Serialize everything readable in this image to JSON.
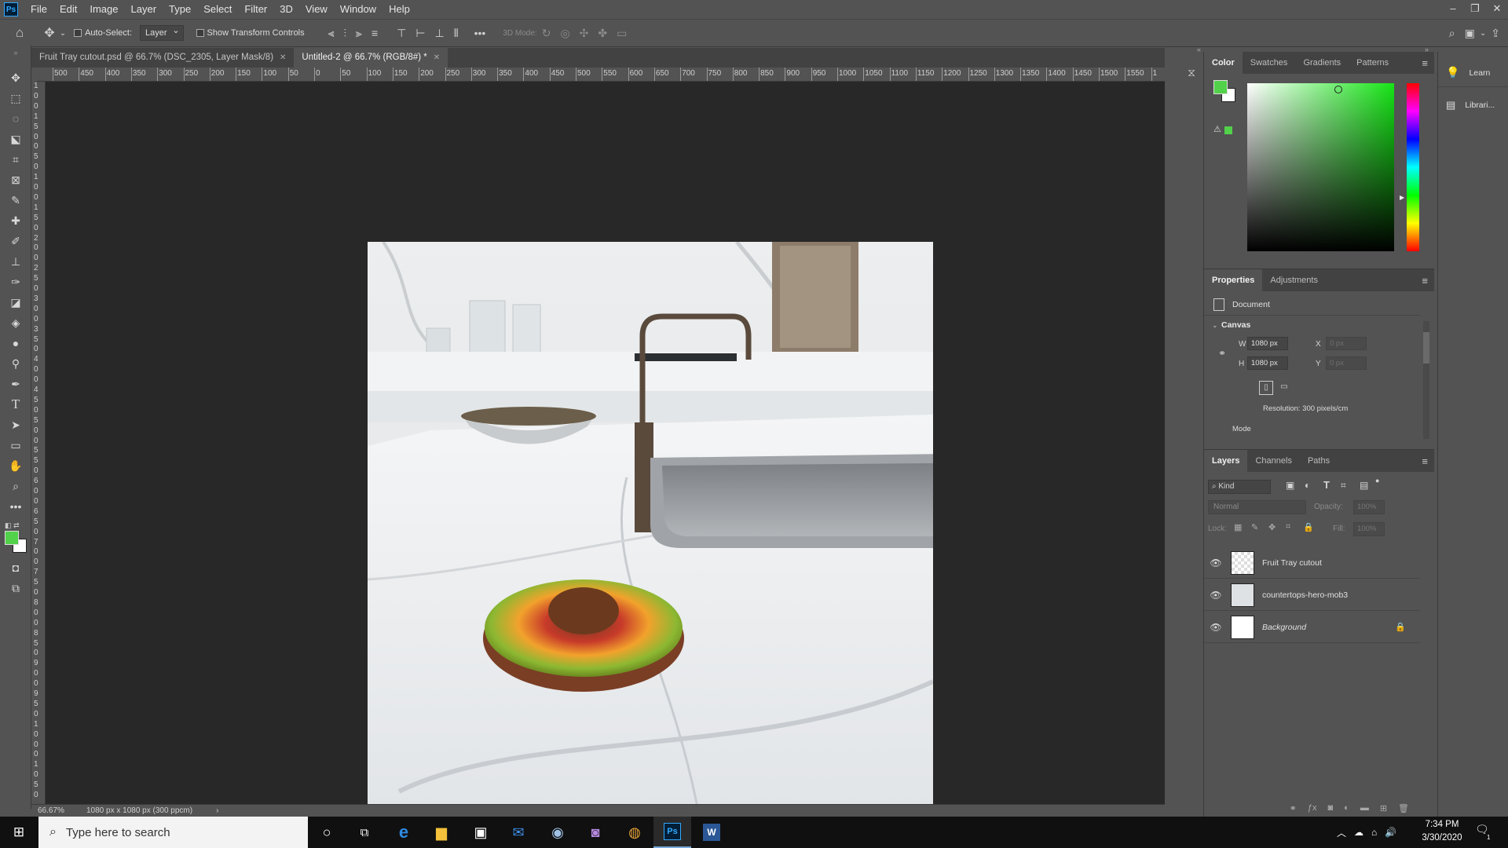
{
  "app": {
    "logo": "Ps"
  },
  "menu": [
    "File",
    "Edit",
    "Image",
    "Layer",
    "Type",
    "Select",
    "Filter",
    "3D",
    "View",
    "Window",
    "Help"
  ],
  "window_controls": {
    "minimize": "–",
    "restore": "❐",
    "close": "✕"
  },
  "options_bar": {
    "auto_select_label": "Auto-Select:",
    "auto_select_value": "Layer",
    "show_transform_label": "Show Transform Controls",
    "mode_3d_label": "3D Mode:",
    "more": "•••"
  },
  "doc_tabs": [
    {
      "label": "Fruit Tray cutout.psd @ 66.7% (DSC_2305, Layer Mask/8)",
      "active": false
    },
    {
      "label": "Untitled-2 @ 66.7% (RGB/8#) *",
      "active": true
    }
  ],
  "ruler_top": [
    "500",
    "450",
    "400",
    "350",
    "300",
    "250",
    "200",
    "150",
    "100",
    "50",
    "0",
    "50",
    "100",
    "150",
    "200",
    "250",
    "300",
    "350",
    "400",
    "450",
    "500",
    "550",
    "600",
    "650",
    "700",
    "750",
    "800",
    "850",
    "900",
    "950",
    "1000",
    "1050",
    "1100",
    "1150",
    "1200",
    "1250",
    "1300",
    "1350",
    "1400",
    "1450",
    "1500",
    "1550",
    "1"
  ],
  "ruler_left": [
    "1",
    "0",
    "0",
    "1",
    "5",
    "0",
    "0",
    "5",
    "0",
    "1",
    "0",
    "0",
    "1",
    "5",
    "0",
    "2",
    "0",
    "0",
    "2",
    "5",
    "0",
    "3",
    "0",
    "0",
    "3",
    "5",
    "0",
    "4",
    "0",
    "0",
    "4",
    "5",
    "0",
    "5",
    "0",
    "0",
    "5",
    "5",
    "0",
    "6",
    "0",
    "0",
    "6",
    "5",
    "0",
    "7",
    "0",
    "0",
    "7",
    "5",
    "0",
    "8",
    "0",
    "0",
    "8",
    "5",
    "0",
    "9",
    "0",
    "0",
    "9",
    "5",
    "0",
    "1",
    "0",
    "0",
    "0",
    "1",
    "0",
    "5",
    "0"
  ],
  "status": {
    "zoom": "66.67%",
    "doc_info": "1080 px x 1080 px (300 ppcm)",
    "arrow": "›"
  },
  "colors": {
    "foreground": "#52d14a",
    "background": "#ffffff",
    "picker_hue": "#16e416"
  },
  "color_panel": {
    "tabs": [
      "Color",
      "Swatches",
      "Gradients",
      "Patterns"
    ],
    "warn": "⚠"
  },
  "properties_panel": {
    "tabs": [
      "Properties",
      "Adjustments"
    ],
    "doc_label": "Document",
    "section": "Canvas",
    "w_label": "W",
    "w_value": "1080 px",
    "h_label": "H",
    "h_value": "1080 px",
    "x_label": "X",
    "x_placeholder": "0 px",
    "y_label": "Y",
    "y_placeholder": "0 px",
    "resolution": "Resolution: 300 pixels/cm",
    "mode_label": "Mode"
  },
  "layers_panel": {
    "tabs": [
      "Layers",
      "Channels",
      "Paths"
    ],
    "filter": "Kind",
    "blend": "Normal",
    "opacity_label": "Opacity:",
    "opacity_value": "100%",
    "lock_label": "Lock:",
    "fill_label": "Fill:",
    "fill_value": "100%",
    "layers": [
      {
        "name": "Fruit Tray cutout",
        "visible": true
      },
      {
        "name": "countertops-hero-mob3",
        "visible": true
      },
      {
        "name": "Background",
        "visible": true,
        "locked": true
      }
    ]
  },
  "learn_panel": {
    "learn": "Learn",
    "libraries": "Librari..."
  },
  "taskbar": {
    "search_placeholder": "Type here to search",
    "time": "7:34 PM",
    "date": "3/30/2020",
    "notif_count": "1"
  }
}
